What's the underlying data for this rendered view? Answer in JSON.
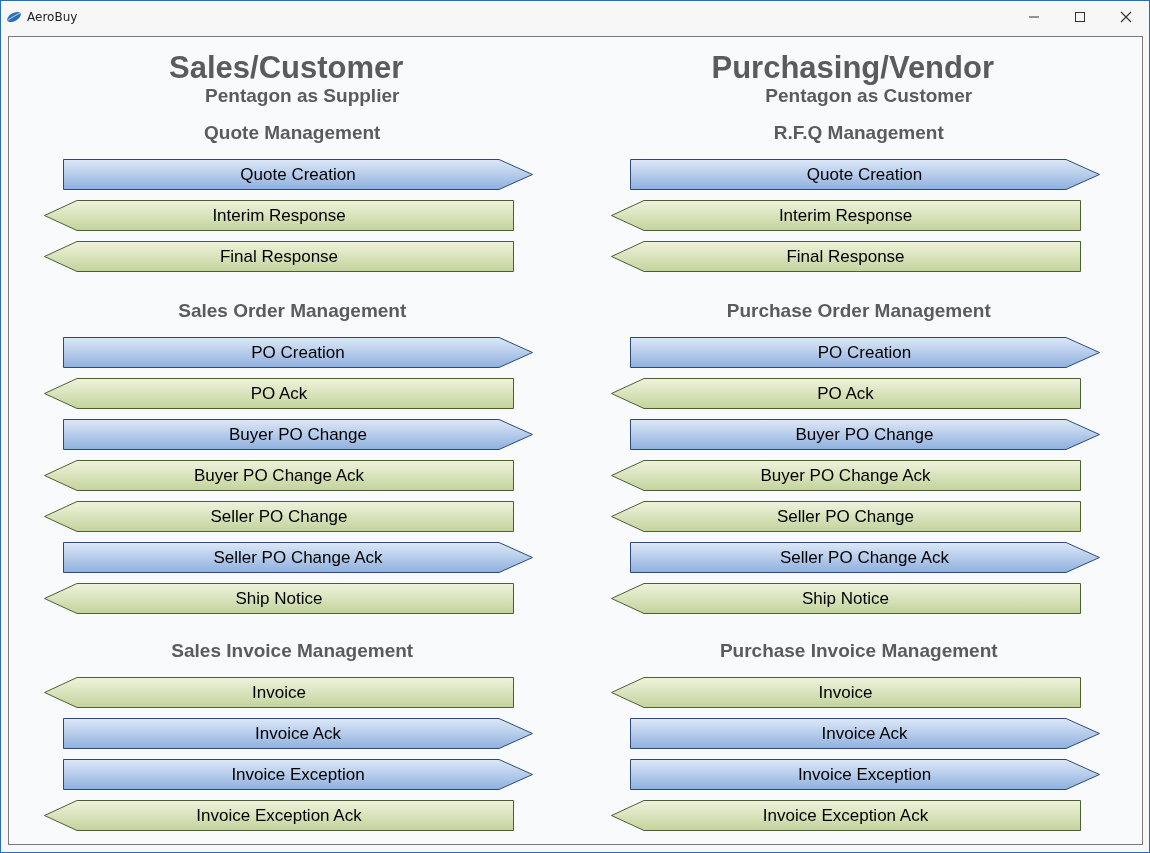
{
  "window": {
    "title": "AeroBuy"
  },
  "columns": [
    {
      "title": "Sales/Customer",
      "subtitle": "Pentagon as Supplier",
      "sections": [
        {
          "heading": "Quote Management",
          "steps": [
            {
              "label": "Quote Creation",
              "kind": "outbound"
            },
            {
              "label": "Interim Response",
              "kind": "inbound"
            },
            {
              "label": "Final Response",
              "kind": "inbound"
            }
          ]
        },
        {
          "heading": "Sales Order Management",
          "steps": [
            {
              "label": "PO Creation",
              "kind": "outbound"
            },
            {
              "label": "PO Ack",
              "kind": "inbound"
            },
            {
              "label": "Buyer PO Change",
              "kind": "outbound"
            },
            {
              "label": "Buyer PO Change Ack",
              "kind": "inbound"
            },
            {
              "label": "Seller PO Change",
              "kind": "inbound"
            },
            {
              "label": "Seller PO Change Ack",
              "kind": "outbound"
            },
            {
              "label": "Ship Notice",
              "kind": "inbound"
            }
          ]
        },
        {
          "heading": "Sales Invoice Management",
          "steps": [
            {
              "label": "Invoice",
              "kind": "inbound"
            },
            {
              "label": "Invoice Ack",
              "kind": "outbound"
            },
            {
              "label": "Invoice Exception",
              "kind": "outbound"
            },
            {
              "label": "Invoice Exception Ack",
              "kind": "inbound"
            }
          ]
        }
      ]
    },
    {
      "title": "Purchasing/Vendor",
      "subtitle": "Pentagon as Customer",
      "sections": [
        {
          "heading": "R.F.Q Management",
          "steps": [
            {
              "label": "Quote Creation",
              "kind": "outbound"
            },
            {
              "label": "Interim Response",
              "kind": "inbound"
            },
            {
              "label": "Final Response",
              "kind": "inbound"
            }
          ]
        },
        {
          "heading": "Purchase Order Management",
          "steps": [
            {
              "label": "PO Creation",
              "kind": "outbound"
            },
            {
              "label": "PO Ack",
              "kind": "inbound"
            },
            {
              "label": "Buyer PO Change",
              "kind": "outbound"
            },
            {
              "label": "Buyer PO Change Ack",
              "kind": "inbound"
            },
            {
              "label": "Seller PO Change",
              "kind": "inbound"
            },
            {
              "label": "Seller PO Change Ack",
              "kind": "outbound"
            },
            {
              "label": "Ship Notice",
              "kind": "inbound"
            }
          ]
        },
        {
          "heading": "Purchase Invoice Management",
          "steps": [
            {
              "label": "Invoice",
              "kind": "inbound"
            },
            {
              "label": "Invoice Ack",
              "kind": "outbound"
            },
            {
              "label": "Invoice Exception",
              "kind": "outbound"
            },
            {
              "label": "Invoice Exception Ack",
              "kind": "inbound"
            }
          ]
        }
      ]
    }
  ]
}
